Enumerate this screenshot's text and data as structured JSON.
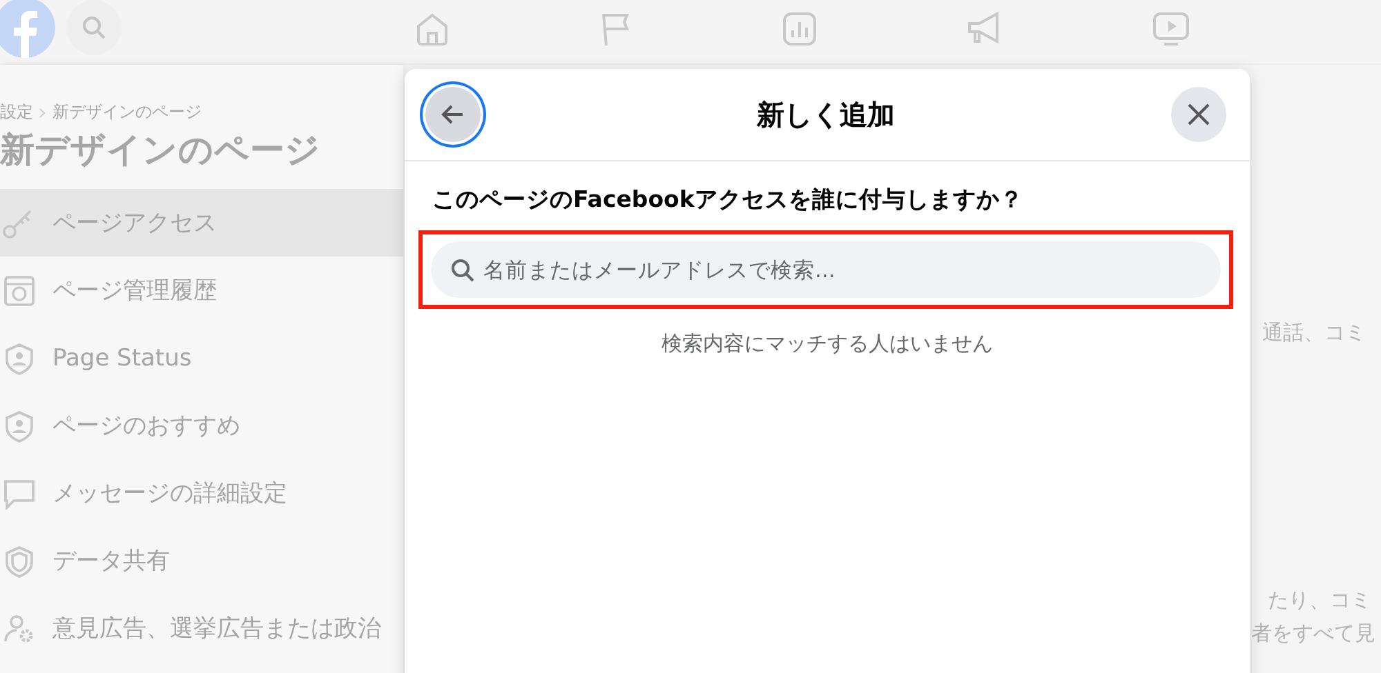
{
  "sidebar": {
    "breadcrumb": [
      "設定",
      "新デザインのページ"
    ],
    "title": "新デザインのページ",
    "items": [
      {
        "label": "ページアクセス",
        "kind": "key",
        "selected": true
      },
      {
        "label": "ページ管理履歴",
        "kind": "history",
        "selected": false
      },
      {
        "label": "Page Status",
        "kind": "status",
        "selected": false
      },
      {
        "label": "ページのおすすめ",
        "kind": "status",
        "selected": false
      },
      {
        "label": "メッセージの詳細設定",
        "kind": "chat",
        "selected": false
      },
      {
        "label": "データ共有",
        "kind": "shield",
        "selected": false
      },
      {
        "label": "意見広告、選挙広告または政治",
        "kind": "ads",
        "selected": false
      }
    ]
  },
  "content": {
    "snippets": [
      "通話、コミ",
      "たり、コミ",
      "者をすべて見"
    ]
  },
  "dialog": {
    "title": "新しく追加",
    "back_button": {
      "focused": true
    },
    "question": "このページのFacebookアクセスを誰に付与しますか？",
    "search": {
      "placeholder": "名前またはメールアドレスで検索...",
      "highlighted": true
    },
    "empty_message": "検索内容にマッチする人はいません"
  }
}
